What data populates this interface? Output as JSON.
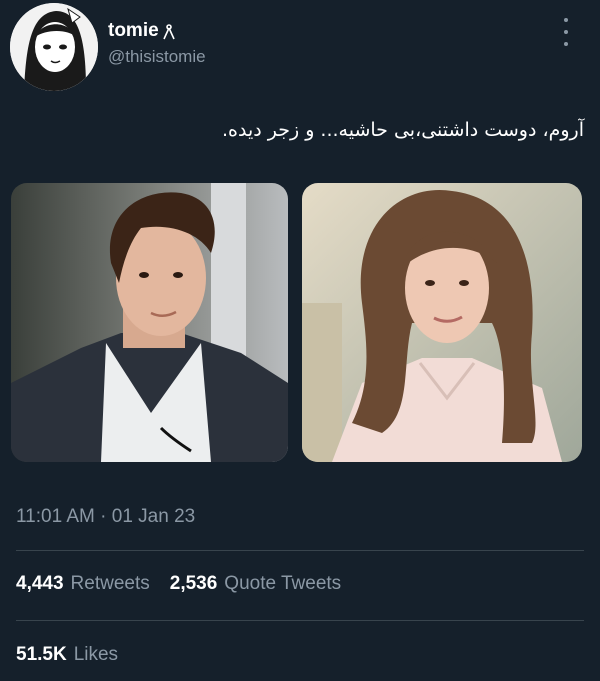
{
  "author": {
    "display_name": "tomie𖱩",
    "display_name_text": "tomie",
    "name_badge": "𖱩",
    "handle": "@thisistomie",
    "avatar_icon": "profile-avatar-icon"
  },
  "tweet": {
    "text": "آروم، دوست داشتنی،بی حاشیه... و زجر دیده.",
    "timestamp": "11:01 AM · 01 Jan 23"
  },
  "media": [
    {
      "name": "photo-man"
    },
    {
      "name": "photo-woman"
    }
  ],
  "stats": {
    "retweets_count": "4,443",
    "retweets_label": "Retweets",
    "quotes_count": "2,536",
    "quotes_label": "Quote Tweets",
    "likes_count": "51.5K",
    "likes_label": "Likes"
  },
  "colors": {
    "background": "#15202b",
    "secondary_text": "#8b98a5",
    "divider": "#38444d"
  }
}
